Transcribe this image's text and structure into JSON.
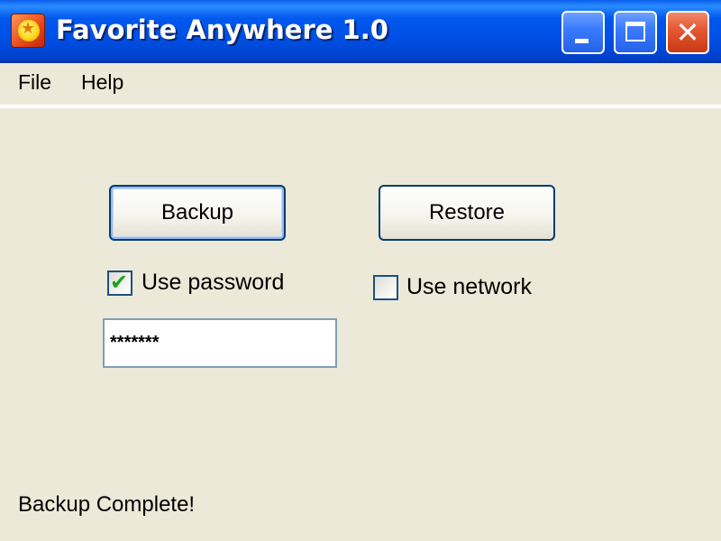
{
  "window": {
    "title": "Favorite Anywhere 1.0",
    "app_icon": "favorite-star-icon",
    "controls": {
      "minimize_icon": "minimize-icon",
      "maximize_icon": "maximize-icon",
      "close_icon": "close-icon",
      "close_glyph": "✕"
    }
  },
  "menu": {
    "items": [
      {
        "label": "File"
      },
      {
        "label": "Help"
      }
    ]
  },
  "actions": {
    "backup_label": "Backup",
    "restore_label": "Restore"
  },
  "options": {
    "use_password": {
      "label": "Use password",
      "checked": true
    },
    "use_network": {
      "label": "Use network",
      "checked": false
    }
  },
  "password": {
    "value": "*******"
  },
  "status": {
    "text": "Backup Complete!"
  },
  "colors": {
    "titlebar": "#0054E3",
    "window_bg": "#ECE9D8",
    "check_mark": "#21A121",
    "close_button": "#E55A35"
  }
}
